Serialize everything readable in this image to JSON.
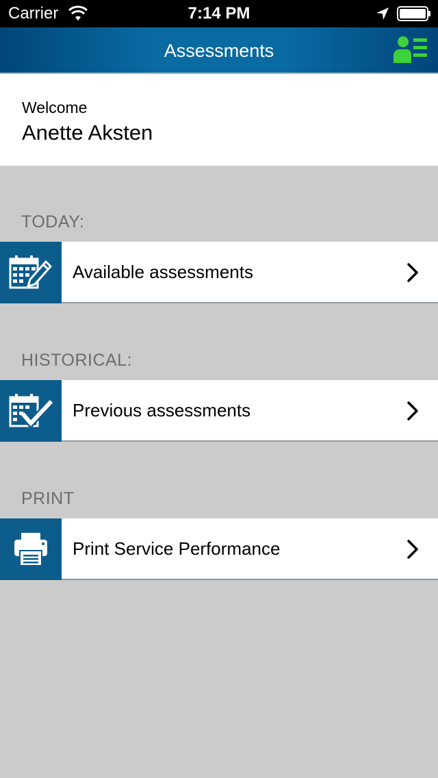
{
  "status_bar": {
    "carrier": "Carrier",
    "time": "7:14 PM",
    "wifi_icon": "wifi-icon",
    "location_icon": "location-arrow-icon",
    "battery_icon": "battery-icon"
  },
  "nav": {
    "title": "Assessments",
    "profile_icon": "user-list-icon",
    "accent_color": "#3dd13b"
  },
  "welcome": {
    "greeting": "Welcome",
    "username": "Anette Aksten"
  },
  "sections": [
    {
      "header": "TODAY:",
      "item_label": "Available assessments",
      "icon": "calendar-edit-icon"
    },
    {
      "header": "HISTORICAL:",
      "item_label": "Previous assessments",
      "icon": "calendar-check-icon"
    },
    {
      "header": "PRINT",
      "item_label": "Print Service Performance",
      "icon": "printer-icon"
    }
  ],
  "colors": {
    "nav_blue": "#0a6aa2",
    "tile_blue": "#0c5c8c",
    "background_gray": "#cbcbcb",
    "header_gray": "#6d6d6d"
  }
}
